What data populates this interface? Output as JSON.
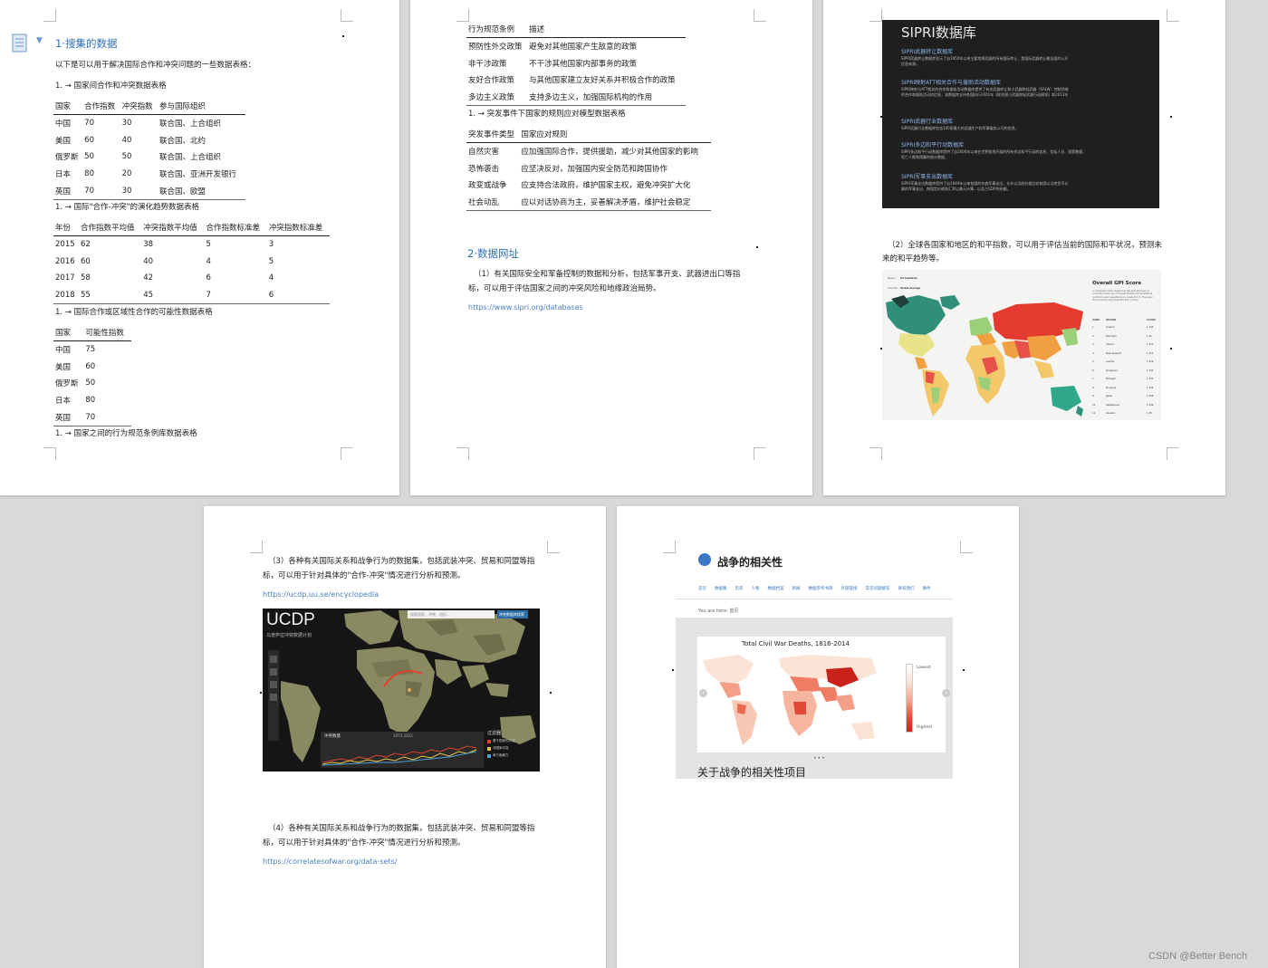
{
  "watermark": "CSDN @Better Bench",
  "p1": {
    "h1": "1·搜集的数据",
    "intro": "以下是可以用于解决国际合作和冲突问题的一些数据表格：",
    "cap1": "1. → 国家间合作和冲突数据表格",
    "t1": {
      "head": [
        "国家",
        "合作指数",
        "冲突指数",
        "参与国际组织"
      ],
      "rows": [
        [
          "中国",
          "70",
          "30",
          "联合国、上合组织"
        ],
        [
          "美国",
          "60",
          "40",
          "联合国、北约"
        ],
        [
          "俄罗斯",
          "50",
          "50",
          "联合国、上合组织"
        ],
        [
          "日本",
          "80",
          "20",
          "联合国、亚洲开发银行"
        ],
        [
          "英国",
          "70",
          "30",
          "联合国、欧盟"
        ]
      ]
    },
    "cap2": "1. → 国际\"合作-冲突\"的演化趋势数据表格",
    "t2": {
      "head": [
        "年份",
        "合作指数平均值",
        "冲突指数平均值",
        "合作指数标准差",
        "冲突指数标准差"
      ],
      "rows": [
        [
          "2015",
          "62",
          "38",
          "5",
          "3"
        ],
        [
          "2016",
          "60",
          "40",
          "4",
          "5"
        ],
        [
          "2017",
          "58",
          "42",
          "6",
          "4"
        ],
        [
          "2018",
          "55",
          "45",
          "7",
          "6"
        ]
      ]
    },
    "cap3": "1. → 国际合作或区域性合作的可能性数据表格",
    "t3": {
      "head": [
        "国家",
        "可能性指数"
      ],
      "rows": [
        [
          "中国",
          "75"
        ],
        [
          "美国",
          "60"
        ],
        [
          "俄罗斯",
          "50"
        ],
        [
          "日本",
          "80"
        ],
        [
          "英国",
          "70"
        ]
      ]
    },
    "cap4": "1. → 国家之间的行为规范条例库数据表格"
  },
  "p2": {
    "t1": {
      "head": [
        "行为规范条例",
        "描述"
      ],
      "rows": [
        [
          "预防性外交政策",
          "避免对其他国家产生敌意的政策"
        ],
        [
          "非干涉政策",
          "不干涉其他国家内部事务的政策"
        ],
        [
          "友好合作政策",
          "与其他国家建立友好关系并积极合作的政策"
        ],
        [
          "多边主义政策",
          "支持多边主义，加强国际机构的作用"
        ]
      ]
    },
    "cap": "1. → 突发事件下国家的规则应对模型数据表格",
    "t2": {
      "head": [
        "突发事件类型",
        "国家应对规则"
      ],
      "rows": [
        [
          "自然灾害",
          "应加强国际合作，提供援助，减少对其他国家的影响"
        ],
        [
          "恐怖袭击",
          "应坚决反对，加强国内安全防范和跨国协作"
        ],
        [
          "政变或战争",
          "应支持合法政府，维护国家主权，避免冲突扩大化"
        ],
        [
          "社会动乱",
          "应以对话协商为主，妥善解决矛盾，维护社会稳定"
        ]
      ]
    },
    "h2": "2·数据网址",
    "para1a": "（1）有关国际安全和军备控制的数据和分析，包括军事开支、武器进出口等指",
    "para1b": "标，可以用于评估国家之间的冲突风险和地缘政治局势。",
    "link": "https://www.sipri.org/databases"
  },
  "p3": {
    "sipri_title": "SIPRI数据库",
    "items": [
      {
        "title": "SIPRI武器转让数据库",
        "desc": "SIPRI武器转让数据库显示了自1950年以来主要常规武器的所有国际转让，是国际武器转让最全面的公开",
        "desc2": "信息来源。"
      },
      {
        "title": "SIPRI映射ATT相关合作与援助活动数据库",
        "desc": "SIPRI映射与ATT相关的合作和援助活动数据库提供了有关武器转让和小武器和轻武器（SALW）控制领域",
        "desc2": "的合作和援助活动的信息，该数据库支持各国执行2001年《联合国小武器和轻武器行动纲领》和2013年"
      },
      {
        "title": "SIPRI武器行业数据库",
        "desc": "SIPRI武器行业数据库包含100家最大的武器生产和军事服务公司的信息。",
        "desc2": ""
      },
      {
        "title": "SIPRI多边和平行动数据库",
        "desc": "SIPRI多边和平行动数据库提供了自2000年以来在世界各地开展的所有多边和平行动的信息，包括人员、国家数据、",
        "desc2": "死亡人数和预算的统计数据。"
      },
      {
        "title": "SIPRI军事支出数据库",
        "desc": "SIPRI军事支出数据库提供了自1949年以来各国的年度军事支出，允许以当前价格比较各国以当地货币计",
        "desc2": "算的军事支出、按固定价格和汇率以美元计算，以及占GDP的份额。"
      }
    ],
    "para_a": "（2）全球各国家和地区的和平指数，可以用于评估当前的国际和平状况，预测未",
    "para_b": "来的和平趋势等。",
    "gpi": {
      "title": "Overall GPI Score",
      "desc": "A composite index measuring the peacefulness of countries made up of 23 quantitative and qualitative indicators each weighted on a scale of 1-5. The lower the score the more peaceful the country.",
      "region_label": "Region",
      "region_val": "All Countries",
      "indicator_label": "Indicator",
      "indicator_val": "Global Average",
      "year_label": "Year",
      "year_val": "2023",
      "cols": [
        "RANK",
        "REGION",
        "SCORE"
      ],
      "rows": [
        [
          "1",
          "Iceland",
          "1.124"
        ],
        [
          "2",
          "Denmark",
          "1.31"
        ],
        [
          "3",
          "Ireland",
          "1.312"
        ],
        [
          "4",
          "New Zealand",
          "1.313"
        ],
        [
          "5",
          "Austria",
          "1.316"
        ],
        [
          "6",
          "Singapore",
          "1.332"
        ],
        [
          "7",
          "Portugal",
          "1.333"
        ],
        [
          "8",
          "Slovenia",
          "1.334"
        ],
        [
          "9",
          "Japan",
          "1.336"
        ],
        [
          "10",
          "Switzerland",
          "1.339"
        ],
        [
          "11",
          "Canada",
          "1.35"
        ]
      ]
    }
  },
  "p4": {
    "para_a": "（3）各种有关国际关系和战争行为的数据集，包括武装冲突、贸易和同盟等指",
    "para_b": "标，可以用于针对具体的\"合作-冲突\"情况进行分析和预测。",
    "link": "https://ucdp.uu.se/encyclopedia",
    "ucdp": {
      "logo": "UCDP",
      "sub": "乌普萨拉冲突数据计划",
      "search_placeholder": "搜索国家、冲突、组织...",
      "btn": "冲突数据库搜索",
      "chart_title": "冲突数量",
      "chart_range": "1975-2022",
      "filter_title": "过滤器",
      "filters": [
        "基于国家的冲突",
        "非国家冲突",
        "单方面暴力"
      ]
    },
    "para2_a": "（4）各种有关国际关系和战争行为的数据集，包括武装冲突、贸易和同盟等指",
    "para2_b": "标，可以用于针对具体的\"合作-冲突\"情况进行分析和预测。",
    "link2": "https://correlatesofwar.org/data-sets/"
  },
  "p5": {
    "site_title": "战争的相关性",
    "nav": [
      "首页",
      "数据集",
      "历史",
      "人物",
      "数据档案",
      "新闻",
      "数据参考书目",
      "外部链接",
      "常见问题解答",
      "联系我们",
      "事件"
    ],
    "crumb": "You are here: 首页",
    "map_title": "Total Civil War Deaths, 1816-2014",
    "legend_low": "Lowest",
    "legend_high": "Highest",
    "caption": "关于战争的相关性项目"
  },
  "colors": {
    "heading": "#2f6fb5",
    "link": "#4a7fc0",
    "dark": "#1f1f1f"
  }
}
